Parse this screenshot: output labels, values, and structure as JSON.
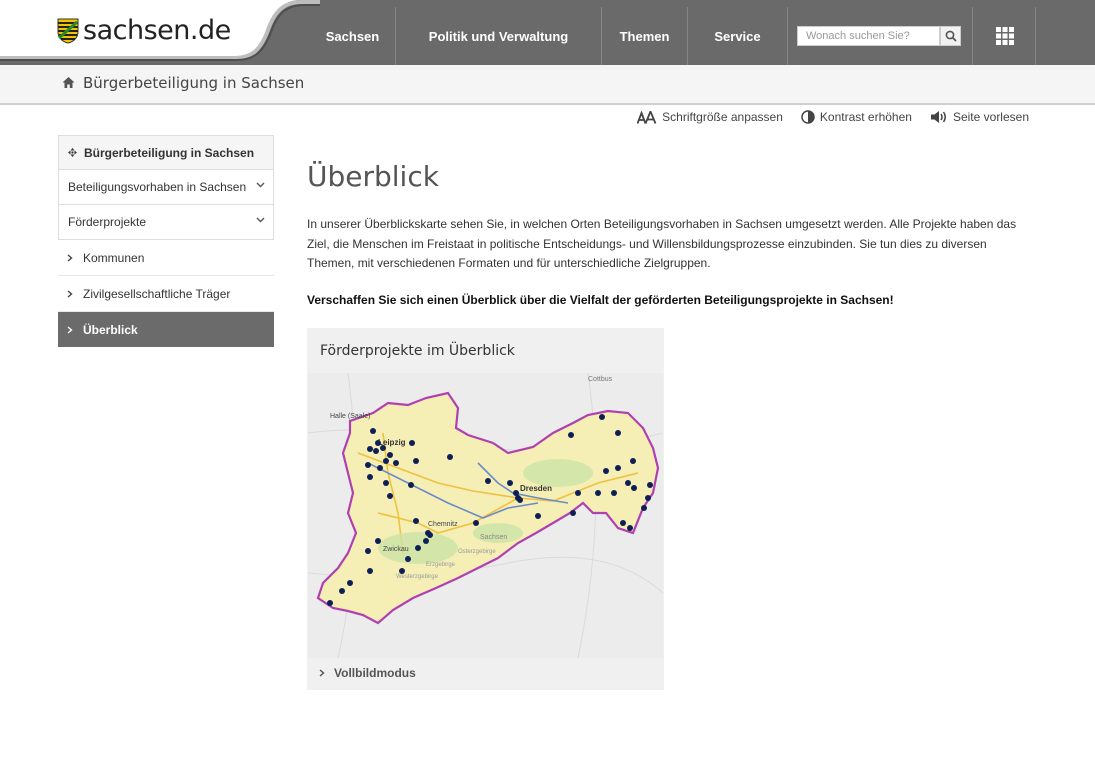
{
  "brand": {
    "name": "sachsen.de"
  },
  "nav": {
    "items": [
      "Sachsen",
      "Politik und Verwaltung",
      "Themen",
      "Service"
    ],
    "search_placeholder": "Wonach suchen Sie?"
  },
  "breadcrumb": {
    "title": "Bürgerbeteiligung in Sachsen"
  },
  "tools": {
    "font_size": "Schriftgröße anpassen",
    "contrast": "Kontrast erhöhen",
    "read_aloud": "Seite vorlesen"
  },
  "sidebar": {
    "items": [
      {
        "label": "Bürgerbeteiligung in Sachsen"
      },
      {
        "label": "Beteiligungsvorhaben in Sachsen"
      },
      {
        "label": "Förderprojekte"
      },
      {
        "label": "Kommunen"
      },
      {
        "label": "Zivilgesellschaftliche Träger"
      },
      {
        "label": "Überblick"
      }
    ]
  },
  "main": {
    "title": "Überblick",
    "intro": "In unserer Überblickskarte sehen Sie, in welchen Orten Beteiligungsvorhaben in Sachsen umgesetzt werden. Alle Projekte haben das Ziel, die Menschen im Freistaat in politische Entscheidungs- und Willensbildungsprozesse einzubinden. Sie tun dies zu diversen Themen, mit verschiedenen Formaten und für unterschiedliche Zielgruppen.",
    "lead": "Verschaffen Sie sich einen Überblick über die Vielfalt der geförderten Beteiligungsprojekte in Sachsen!"
  },
  "card": {
    "title": "Förderprojekte im Überblick",
    "footer_link": "Vollbildmodus",
    "map_labels": {
      "halle": "Halle (Saale)",
      "leipzig": "Leipzig",
      "dresden": "Dresden",
      "chemnitz": "Chemnitz",
      "zwickau": "Zwickau",
      "cottbus": "Cottbus",
      "sachsen": "Sachsen",
      "osterzgebirge": "Osterzgebirge",
      "erzgebirge": "Erzgebirge",
      "westerzgebirge": "Westerzgebirge"
    }
  },
  "colors": {
    "header_gray": "#6a6a6a",
    "sidebar_active": "#6b6b6b",
    "border_purple": "#b040b0",
    "marker": "#0d1f55"
  }
}
